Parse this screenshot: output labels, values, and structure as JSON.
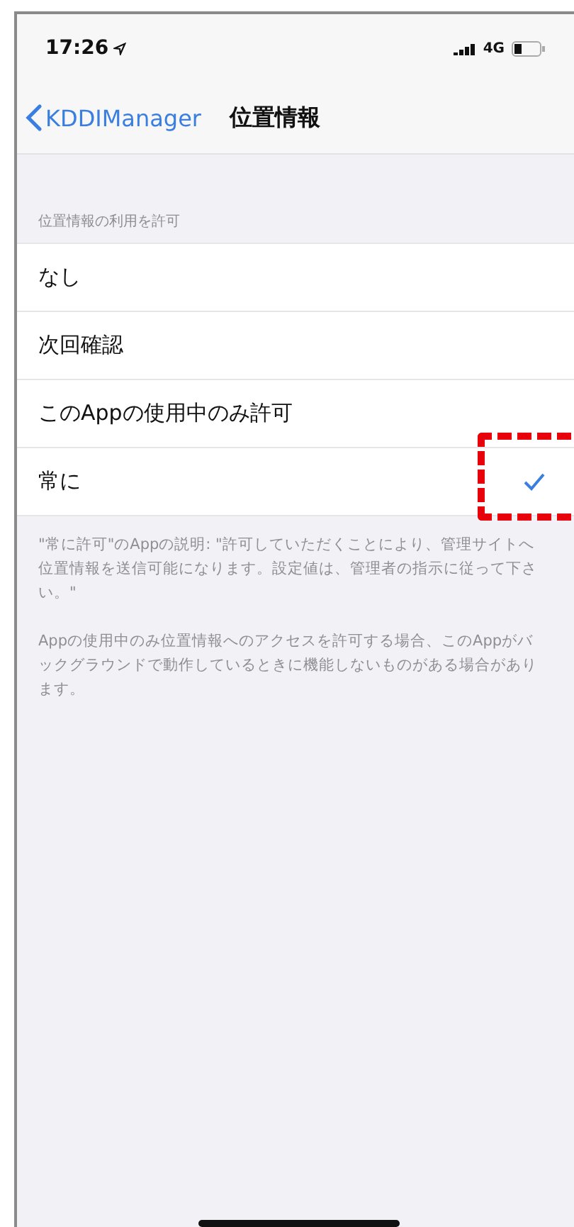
{
  "status_bar": {
    "time": "17:26",
    "network": "4G"
  },
  "nav": {
    "back_label": "KDDIManager",
    "title": "位置情報"
  },
  "section": {
    "header": "位置情報の利用を許可",
    "options": [
      {
        "label": "なし",
        "selected": false,
        "highlighted": false
      },
      {
        "label": "次回確認",
        "selected": false,
        "highlighted": false
      },
      {
        "label": "このAppの使用中のみ許可",
        "selected": false,
        "highlighted": false
      },
      {
        "label": "常に",
        "selected": true,
        "highlighted": true
      }
    ],
    "footer": [
      "\"常に許可\"のAppの説明: \"許可していただくことにより、管理サイトへ位置情報を送信可能になります。設定値は、管理者の指示に従って下さい。\"",
      "Appの使用中のみ位置情報へのアクセスを許可する場合、このAppがバックグラウンドで動作しているときに機能しないものがある場合があります。"
    ]
  }
}
